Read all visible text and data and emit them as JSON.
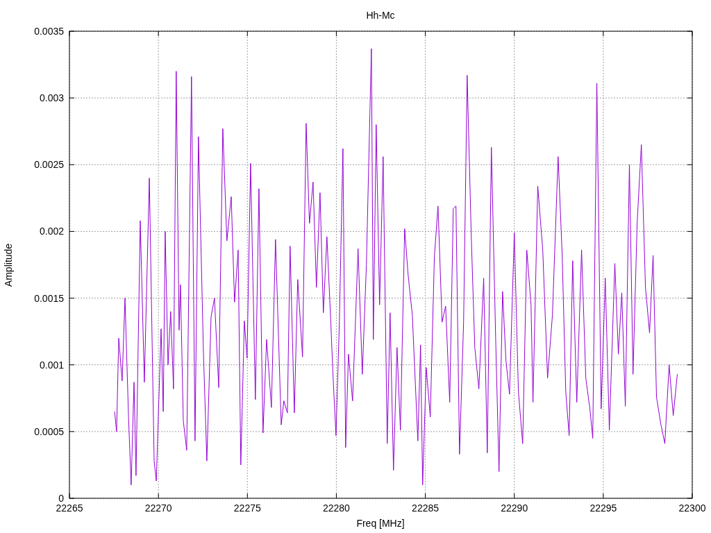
{
  "plot": {
    "chart_data": {
      "type": "line",
      "title": "Hh-Mc",
      "xlabel": "Freq [MHz]",
      "ylabel": "Amplitude",
      "grid": true,
      "xlim": [
        22265,
        22300
      ],
      "ylim": [
        0,
        0.0035
      ],
      "xticks": [
        22265,
        22270,
        22275,
        22280,
        22285,
        22290,
        22295,
        22300
      ],
      "yticks": [
        0,
        0.0005,
        0.001,
        0.0015,
        0.002,
        0.0025,
        0.003,
        0.0035
      ],
      "x": [
        22267.54,
        22267.65,
        22267.77,
        22267.96,
        22268.12,
        22268.32,
        22268.47,
        22268.63,
        22268.74,
        22268.98,
        22269.21,
        22269.49,
        22269.76,
        22269.88,
        22270.15,
        22270.27,
        22270.38,
        22270.54,
        22270.69,
        22270.85,
        22271.0,
        22271.16,
        22271.24,
        22271.4,
        22271.59,
        22271.86,
        22272.06,
        22272.25,
        22272.53,
        22272.72,
        22272.96,
        22273.15,
        22273.39,
        22273.62,
        22273.85,
        22274.09,
        22274.28,
        22274.48,
        22274.63,
        22274.83,
        22274.98,
        22275.18,
        22275.45,
        22275.65,
        22275.88,
        22276.08,
        22276.35,
        22276.58,
        22276.9,
        22277.05,
        22277.25,
        22277.4,
        22277.64,
        22277.83,
        22278.1,
        22278.3,
        22278.49,
        22278.69,
        22278.88,
        22279.08,
        22279.27,
        22279.47,
        22279.67,
        22279.82,
        22279.98,
        22280.17,
        22280.37,
        22280.52,
        22280.68,
        22280.91,
        22281.22,
        22281.46,
        22281.69,
        22281.97,
        22282.08,
        22282.24,
        22282.43,
        22282.63,
        22282.86,
        22283.02,
        22283.21,
        22283.41,
        22283.6,
        22283.84,
        22284.03,
        22284.27,
        22284.58,
        22284.73,
        22284.85,
        22285.05,
        22285.28,
        22285.51,
        22285.71,
        22285.94,
        22286.14,
        22286.37,
        22286.57,
        22286.72,
        22286.92,
        22287.15,
        22287.35,
        22287.58,
        22287.78,
        22288.01,
        22288.28,
        22288.48,
        22288.71,
        22288.95,
        22289.14,
        22289.34,
        22289.53,
        22289.73,
        22290.0,
        22290.23,
        22290.47,
        22290.7,
        22290.94,
        22291.05,
        22291.32,
        22291.6,
        22291.87,
        22292.14,
        22292.46,
        22292.69,
        22292.89,
        22293.08,
        22293.28,
        22293.51,
        22293.78,
        22294.02,
        22294.25,
        22294.41,
        22294.64,
        22294.88,
        22295.11,
        22295.34,
        22295.65,
        22295.85,
        22296.04,
        22296.24,
        22296.47,
        22296.67,
        22296.9,
        22297.14,
        22297.37,
        22297.6,
        22297.8,
        22297.99,
        22298.23,
        22298.46,
        22298.7,
        22298.93,
        22299.16
      ],
      "series": [
        {
          "color": "#9400d3",
          "values": [
            0.00065,
            0.0005,
            0.0012,
            0.00088,
            0.0015,
            0.00061,
            0.0001,
            0.00087,
            0.00017,
            0.00208,
            0.00087,
            0.0024,
            0.00028,
            0.00013,
            0.00127,
            0.00065,
            0.002,
            0.001,
            0.0014,
            0.00082,
            0.0032,
            0.00126,
            0.0016,
            0.00058,
            0.00036,
            0.00316,
            0.00043,
            0.00271,
            0.00109,
            0.00028,
            0.00136,
            0.0015,
            0.00083,
            0.00277,
            0.00193,
            0.00226,
            0.00147,
            0.00186,
            0.00025,
            0.00133,
            0.00105,
            0.00251,
            0.00074,
            0.00232,
            0.00049,
            0.00119,
            0.00068,
            0.00194,
            0.00055,
            0.00073,
            0.00064,
            0.00189,
            0.00064,
            0.00164,
            0.00106,
            0.00281,
            0.00206,
            0.00237,
            0.00158,
            0.00229,
            0.00139,
            0.00196,
            0.00137,
            0.0009,
            0.00047,
            0.00133,
            0.00262,
            0.00038,
            0.00108,
            0.00073,
            0.00187,
            0.00093,
            0.00175,
            0.00337,
            0.00119,
            0.0028,
            0.00145,
            0.00256,
            0.00041,
            0.00139,
            0.00021,
            0.00113,
            0.00051,
            0.00202,
            0.00168,
            0.00137,
            0.00043,
            0.00115,
            0.0001,
            0.00098,
            0.00061,
            0.00181,
            0.00219,
            0.00132,
            0.00144,
            0.00072,
            0.00217,
            0.00219,
            0.00033,
            0.00132,
            0.00317,
            0.00197,
            0.00113,
            0.00082,
            0.00165,
            0.00034,
            0.00263,
            0.00121,
            0.0002,
            0.00155,
            0.00103,
            0.00078,
            0.00199,
            0.0008,
            0.00041,
            0.00186,
            0.00145,
            0.00072,
            0.00234,
            0.00186,
            0.0009,
            0.00137,
            0.00256,
            0.00182,
            0.0008,
            0.00047,
            0.00178,
            0.00072,
            0.00186,
            0.0009,
            0.00067,
            0.00045,
            0.00311,
            0.00067,
            0.00165,
            0.00051,
            0.00176,
            0.00108,
            0.00154,
            0.00069,
            0.0025,
            0.00093,
            0.00206,
            0.00265,
            0.00158,
            0.00124,
            0.00182,
            0.00076,
            0.00056,
            0.00041,
            0.001,
            0.00062,
            0.00093
          ]
        }
      ]
    }
  }
}
